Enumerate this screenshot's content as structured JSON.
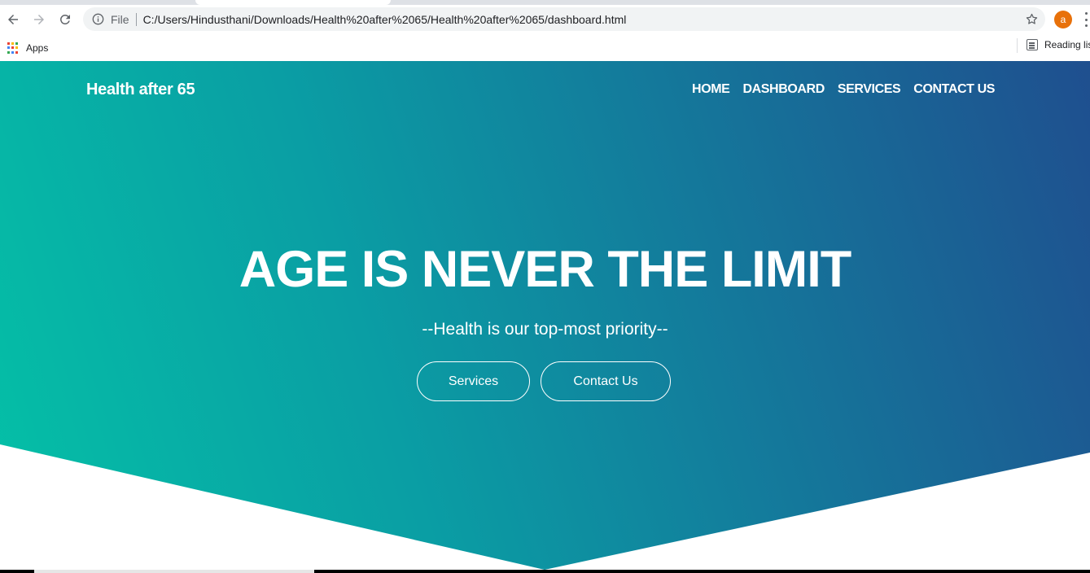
{
  "browser": {
    "address_scheme": "File",
    "address_url": "C:/Users/Hindusthani/Downloads/Health%20after%2065/Health%20after%2065/dashboard.html",
    "profile_initial": "a",
    "profile_color": "#e8710a",
    "icons": {
      "back": "back-arrow-icon",
      "forward": "forward-arrow-icon",
      "reload": "reload-icon",
      "info": "info-icon",
      "bookmark": "star-icon",
      "menu": "kebab-menu-icon",
      "apps": "apps-grid-icon",
      "reading_list": "reading-list-icon"
    },
    "bookmarks_bar": {
      "apps_label": "Apps",
      "reading_list_label": "Reading list"
    }
  },
  "site": {
    "brand": "Health after 65",
    "nav": {
      "home": "HOME",
      "dashboard": "DASHBOARD",
      "services": "SERVICES",
      "contact": "CONTACT US"
    }
  },
  "hero": {
    "headline": "AGE IS NEVER THE LIMIT",
    "tagline": "--Health is our top-most priority--",
    "buttons": {
      "services": "Services",
      "contact": "Contact Us"
    },
    "gradient_colors": [
      "#04c1a7",
      "#0a9ea4",
      "#137c9c",
      "#1f4f8f"
    ]
  }
}
